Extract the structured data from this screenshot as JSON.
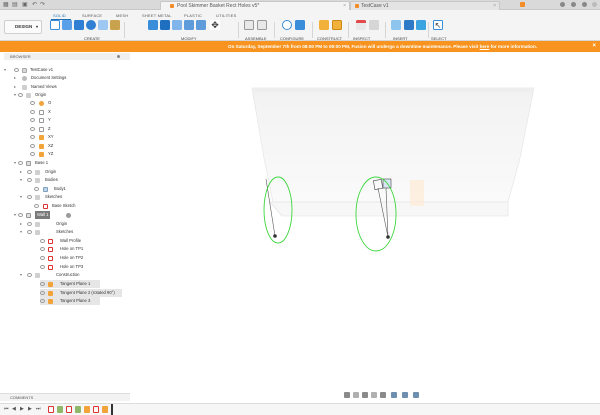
{
  "titlebar": {
    "doc_tab_1": "Pool Skimmer Basket Rect Holes v5*",
    "doc_tab_2": "TestCase v1"
  },
  "toolbar": {
    "workspace_button": "DESIGN",
    "workspace_tabs": [
      "SOLID",
      "SURFACE",
      "MESH",
      "SHEET METAL",
      "PLASTIC",
      "UTILITIES"
    ],
    "groups": [
      "CREATE",
      "MODIFY",
      "ASSEMBLE",
      "CONFIGURE",
      "CONSTRUCT",
      "INSPECT",
      "INSERT",
      "SELECT"
    ]
  },
  "banner": {
    "text": "On Saturday, September 7th from 08:00 PM to 09:00 PM, Fusion will undergo a downtime maintenance. Please visit ",
    "link": "here",
    "tail": " for more information."
  },
  "browser": {
    "title": "BROWSER",
    "nodes": [
      "TestCase v1",
      "Document Settings",
      "Named Views",
      "Origin",
      "O",
      "X",
      "Y",
      "Z",
      "XY",
      "XZ",
      "YZ",
      "Base 1",
      "Origin",
      "Bodies",
      "Body1",
      "Sketches",
      "Base Sketch",
      "Wall 1",
      "Origin",
      "Sketches",
      "Wall Profile",
      "Hole on TP1",
      "Hole on TP2",
      "Hole on TP3",
      "Construction",
      "Tangent Plane 1",
      "Tangent Plane 2 (rotated 90°)",
      "Tangent Plane 3"
    ]
  },
  "comments": {
    "label": "COMMENTS"
  },
  "colors": {
    "accent": "#1e6fb8",
    "banner": "#f7931e",
    "highlight_circle": "#3ed63e",
    "selected_node": "#7a7a7a"
  },
  "icons": {
    "browser_toggle": "chevron-icon",
    "visibility": "eye-icon",
    "folder": "folder-icon",
    "sketch": "sketch-icon",
    "plane": "plane-icon",
    "body": "body-icon"
  }
}
